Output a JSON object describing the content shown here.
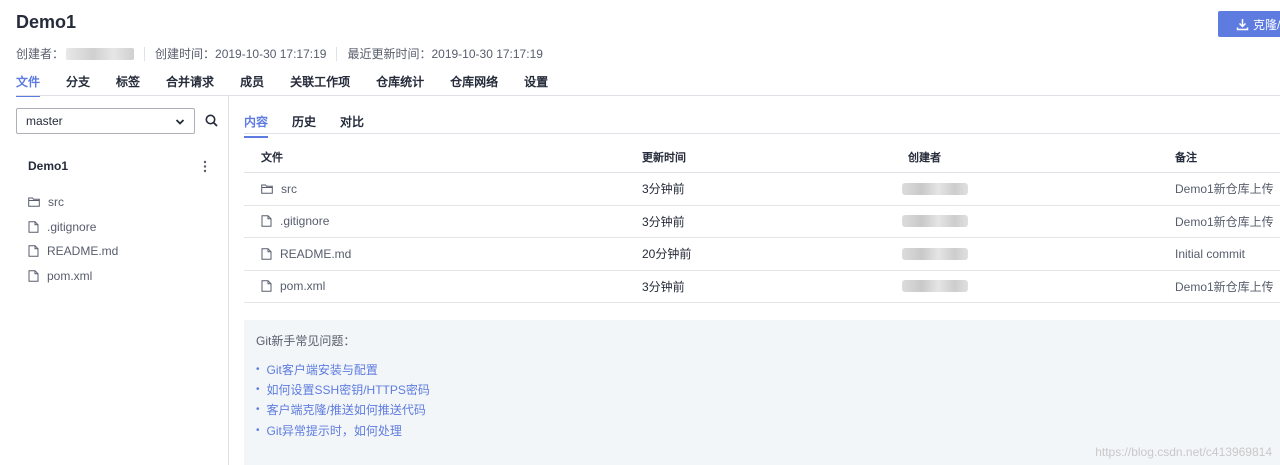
{
  "repo": {
    "title": "Demo1",
    "clone_label": "克隆/",
    "creator_label": "创建者：",
    "created_label": "创建时间：",
    "created_value": "2019-10-30 17:17:19",
    "updated_label": "最近更新时间：",
    "updated_value": "2019-10-30 17:17:19"
  },
  "top_tabs": [
    {
      "label": "文件",
      "active": true
    },
    {
      "label": "分支"
    },
    {
      "label": "标签"
    },
    {
      "label": "合并请求"
    },
    {
      "label": "成员"
    },
    {
      "label": "关联工作项"
    },
    {
      "label": "仓库统计"
    },
    {
      "label": "仓库网络"
    },
    {
      "label": "设置"
    }
  ],
  "sidebar": {
    "branch": "master",
    "repo_name": "Demo1",
    "items": [
      {
        "name": "src",
        "icon": "folder-icon"
      },
      {
        "name": ".gitignore",
        "icon": "file-icon"
      },
      {
        "name": "README.md",
        "icon": "file-icon"
      },
      {
        "name": "pom.xml",
        "icon": "file-icon"
      }
    ]
  },
  "sub_tabs": [
    {
      "label": "内容",
      "active": true
    },
    {
      "label": "历史"
    },
    {
      "label": "对比"
    }
  ],
  "table": {
    "headers": {
      "file": "文件",
      "time": "更新时间",
      "author": "创建者",
      "note": "备注"
    },
    "rows": [
      {
        "file": "src",
        "icon": "folder-icon",
        "time": "3分钟前",
        "note": "Demo1新仓库上传"
      },
      {
        "file": ".gitignore",
        "icon": "file-icon",
        "time": "3分钟前",
        "note": "Demo1新仓库上传"
      },
      {
        "file": "README.md",
        "icon": "file-icon",
        "time": "20分钟前",
        "note": "Initial commit"
      },
      {
        "file": "pom.xml",
        "icon": "file-icon",
        "time": "3分钟前",
        "note": "Demo1新仓库上传"
      }
    ]
  },
  "faq": {
    "title": "Git新手常见问题：",
    "links": [
      "Git客户端安装与配置",
      "如何设置SSH密钥/HTTPS密码",
      "客户端克隆/推送如何推送代码",
      "Git异常提示时，如何处理"
    ]
  },
  "watermark": "https://blog.csdn.net/c413969814",
  "colors": {
    "accent": "#5e7ce0",
    "text": "#252b3a",
    "muted": "#575d6c",
    "faq_bg": "#f3f6f8"
  }
}
